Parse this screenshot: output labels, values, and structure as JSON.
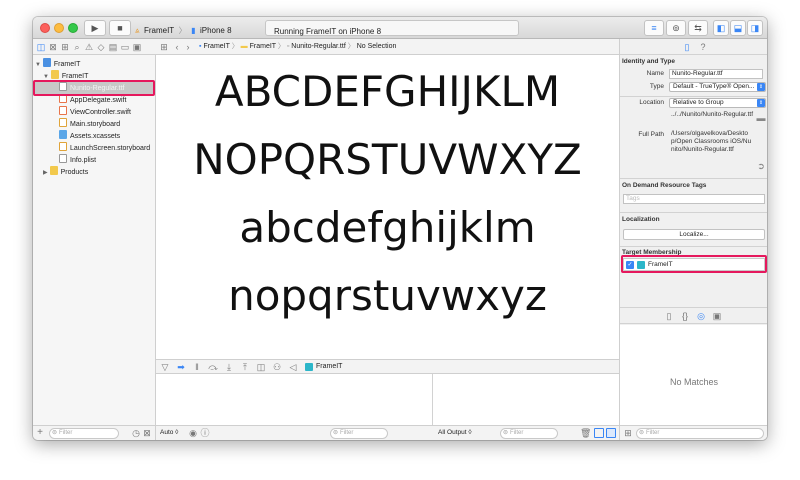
{
  "window": {
    "scheme": "FrameIT",
    "destination": "iPhone 8",
    "activity": "Running FrameIT on iPhone 8"
  },
  "breadcrumb": {
    "project": "FrameIT",
    "group": "FrameIT",
    "file": "Nunito-Regular.ttf",
    "selection": "No Selection"
  },
  "navigator": {
    "items": [
      {
        "label": "FrameIT",
        "kind": "project"
      },
      {
        "label": "FrameIT",
        "kind": "folder"
      },
      {
        "label": "Nunito-Regular.ttf",
        "kind": "font"
      },
      {
        "label": "AppDelegate.swift",
        "kind": "swift"
      },
      {
        "label": "ViewController.swift",
        "kind": "swift"
      },
      {
        "label": "Main.storyboard",
        "kind": "storyboard"
      },
      {
        "label": "Assets.xcassets",
        "kind": "assets"
      },
      {
        "label": "LaunchScreen.storyboard",
        "kind": "storyboard"
      },
      {
        "label": "Info.plist",
        "kind": "plist"
      },
      {
        "label": "Products",
        "kind": "folder"
      }
    ],
    "filter_placeholder": "Filter"
  },
  "editor": {
    "preview_lines": [
      "ABCDEFGHIJKLM",
      "NOPQRSTUVWXYZ",
      "abcdefghijklm",
      "nopqrstuvwxyz"
    ]
  },
  "debug": {
    "target_label": "FrameIT",
    "auto_label": "Auto ◊",
    "filter_placeholder": "Filter",
    "output_label": "All Output ◊",
    "output_filter_placeholder": "Filter"
  },
  "inspector": {
    "identity_title": "Identity and Type",
    "name_label": "Name",
    "name_value": "Nunito-Regular.ttf",
    "type_label": "Type",
    "type_value": "Default - TrueType® Open...",
    "location_label": "Location",
    "location_value": "Relative to Group",
    "relative_path": "../../Nunito/Nunito-Regular.ttf",
    "full_path_label": "Full Path",
    "full_path_value": "/Users/olgavelkova/Desktop/Open Classrooms iOS/Nunito/Nunito-Regular.ttf",
    "odr_title": "On Demand Resource Tags",
    "tags_placeholder": "Tags",
    "localization_title": "Localization",
    "localize_button": "Localize...",
    "membership_title": "Target Membership",
    "membership_target": "FrameIT",
    "membership_checked": true,
    "library_empty": "No Matches",
    "library_filter_placeholder": "Filter"
  },
  "colors": {
    "highlight": "#e5185d",
    "accent": "#3a86f5",
    "folder": "#f2c94c"
  }
}
